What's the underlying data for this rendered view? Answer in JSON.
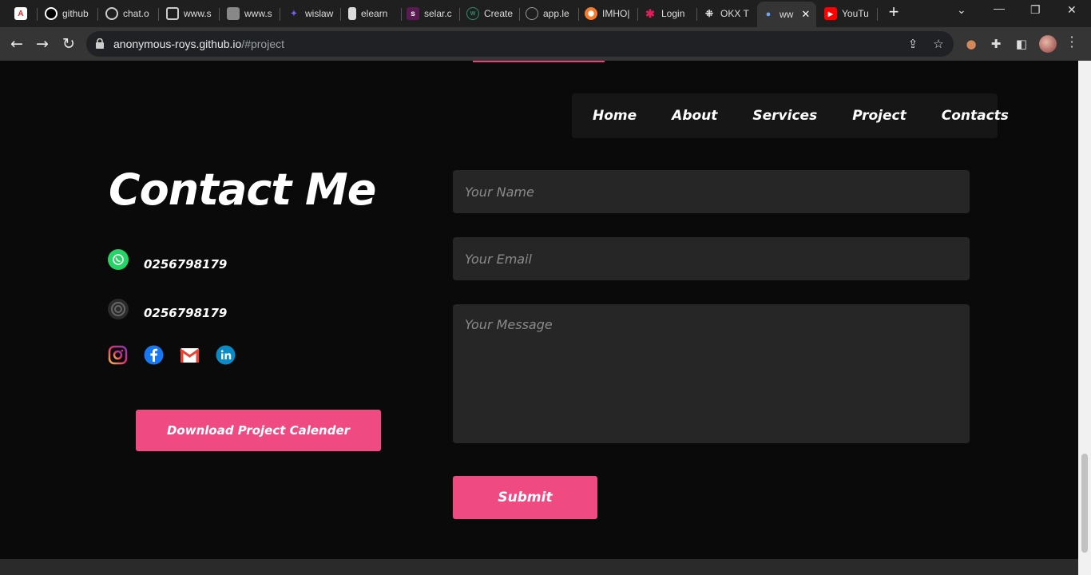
{
  "browser": {
    "tabs": [
      {
        "label": "",
        "icon": "acrobat-icon",
        "color": "#e22b2b"
      },
      {
        "label": "github",
        "icon": "github-icon",
        "color": "#ffffff"
      },
      {
        "label": "chat.o",
        "icon": "openai-icon",
        "color": "#cccccc"
      },
      {
        "label": "www.s",
        "icon": "window-icon",
        "color": "#cccccc"
      },
      {
        "label": "www.s",
        "icon": "cube-icon",
        "color": "#cccccc"
      },
      {
        "label": "wislaw",
        "icon": "wislaw-icon",
        "color": "#7a5cff"
      },
      {
        "label": "elearn",
        "icon": "page-icon",
        "color": "#cccccc"
      },
      {
        "label": "selar.c",
        "icon": "selar-icon",
        "color": "#9b2a8a"
      },
      {
        "label": "Create",
        "icon": "create-icon",
        "color": "#2f8f6a"
      },
      {
        "label": "app.le",
        "icon": "app-icon",
        "color": "#888888"
      },
      {
        "label": "IMHO|",
        "icon": "imho-icon",
        "color": "#f57c2a"
      },
      {
        "label": "Login",
        "icon": "slack-icon",
        "color": "#e01e5a"
      },
      {
        "label": "OKX T",
        "icon": "okx-icon",
        "color": "#ffffff"
      },
      {
        "label": "ww",
        "icon": "pin-icon",
        "color": "#6aa8ff"
      },
      {
        "label": "YouTu",
        "icon": "youtube-icon",
        "color": "#ff0000"
      }
    ],
    "url_host": "anonymous-roys.github.io",
    "url_path": "/#project"
  },
  "nav": {
    "items": [
      "Home",
      "About",
      "Services",
      "Project",
      "Contacts"
    ]
  },
  "contact": {
    "title": "Contact Me",
    "whatsapp_number": "0256798179",
    "phone_number": "0256798179",
    "download_label": "Download Project Calender"
  },
  "form": {
    "name_placeholder": "Your Name",
    "email_placeholder": "Your Email",
    "message_placeholder": "Your Message",
    "submit_label": "Submit"
  },
  "colors": {
    "accent": "#ef4b82",
    "background": "#0b0a0b",
    "field_bg": "#262626",
    "nav_bg": "#161616"
  }
}
